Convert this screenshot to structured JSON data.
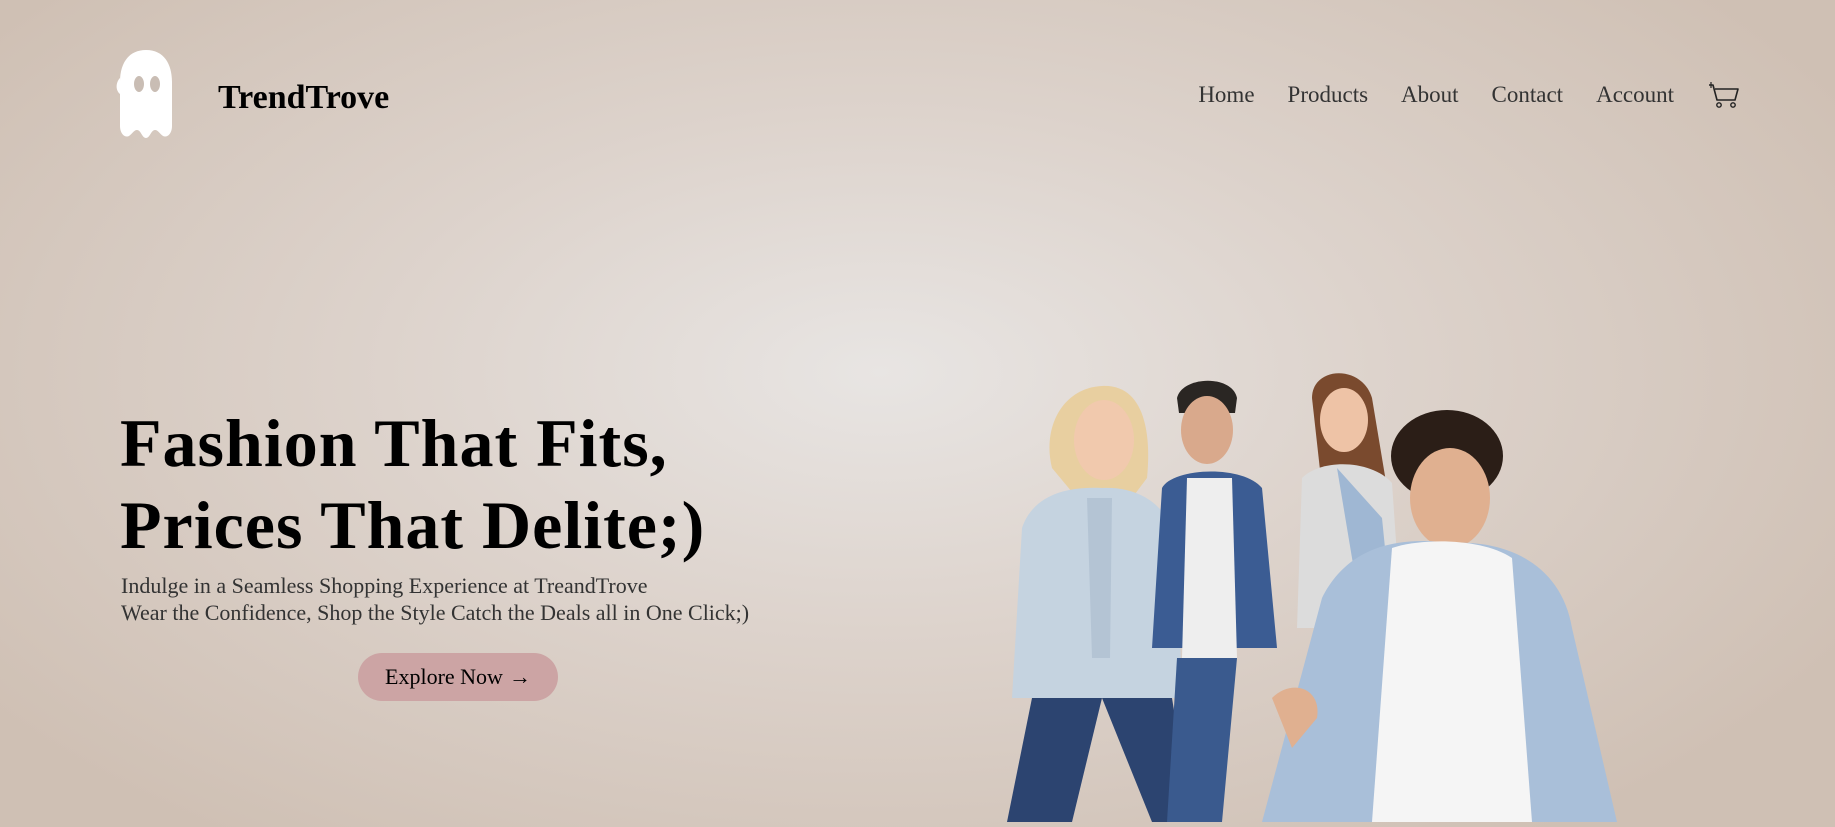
{
  "brand": {
    "name": "TrendTrove",
    "logo_icon": "ghost-icon"
  },
  "nav": {
    "items": [
      {
        "label": "Home"
      },
      {
        "label": "Products"
      },
      {
        "label": "About"
      },
      {
        "label": "Contact"
      },
      {
        "label": "Account"
      }
    ],
    "cart_icon": "cart-icon"
  },
  "hero": {
    "title_line1": "Fashion That Fits,",
    "title_line2": "Prices That Delite;)",
    "subtitle_line1": "Indulge in a Seamless Shopping Experience at TreandTrove",
    "subtitle_line2": "Wear the Confidence, Shop the Style Catch the Deals all in One Click;)",
    "cta_label": "Explore Now",
    "cta_icon": "arrow-right-icon",
    "cta_arrow": "→"
  },
  "colors": {
    "cta_bg": "#cca4a4",
    "bg_center": "#e8e5e3",
    "bg_edge": "#cfc0b4"
  }
}
